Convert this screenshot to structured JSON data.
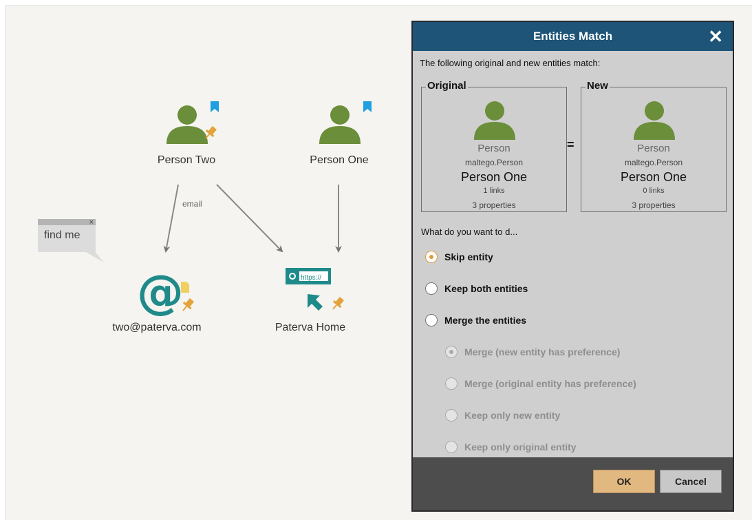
{
  "graph": {
    "nodes": [
      {
        "id": "person-two",
        "label": "Person Two",
        "icon": "person-icon",
        "bookmark": true,
        "pinned": true
      },
      {
        "id": "person-one",
        "label": "Person One",
        "icon": "person-icon",
        "bookmark": true,
        "pinned": false
      },
      {
        "id": "email",
        "label": "two@paterva.com",
        "icon": "email-at-icon",
        "note_attached": true,
        "pinned": true
      },
      {
        "id": "website",
        "label": "Paterva Home",
        "icon": "website-icon",
        "url_badge": "https://",
        "pinned": true
      }
    ],
    "edges": [
      {
        "from": "person-two",
        "to": "email",
        "label": "email"
      },
      {
        "from": "person-two",
        "to": "website",
        "label": ""
      },
      {
        "from": "person-one",
        "to": "website",
        "label": ""
      }
    ],
    "note": {
      "text": "find me",
      "close": "×"
    }
  },
  "dialog": {
    "title": "Entities Match",
    "close": "✕",
    "intro": "The following original and new entities match:",
    "original": {
      "legend": "Original",
      "type": "Person",
      "namespace": "maltego.Person",
      "name": "Person One",
      "links": "1 links",
      "properties": "3 properties"
    },
    "new": {
      "legend": "New",
      "type": "Person",
      "namespace": "maltego.Person",
      "name": "Person One",
      "links": "0 links",
      "properties": "3 properties"
    },
    "equals": "=",
    "question": "What do you want to d...",
    "options": [
      {
        "label": "Skip entity",
        "checked": true,
        "enabled": true
      },
      {
        "label": "Keep both entities",
        "checked": false,
        "enabled": true
      },
      {
        "label": "Merge the entities",
        "checked": false,
        "enabled": true
      }
    ],
    "merge_options": [
      {
        "label": "Merge (new entity has preference)",
        "checked": true,
        "enabled": false
      },
      {
        "label": "Merge (original entity has preference)",
        "checked": false,
        "enabled": false
      },
      {
        "label": "Keep only new entity",
        "checked": false,
        "enabled": false
      },
      {
        "label": "Keep only original entity",
        "checked": false,
        "enabled": false
      }
    ],
    "buttons": {
      "ok": "OK",
      "cancel": "Cancel"
    }
  },
  "colors": {
    "person": "#6b8e3a",
    "entity_teal": "#1f8a8a",
    "pin": "#e3a33a",
    "bookmark": "#1fa0e0",
    "title_bar": "#1d5478",
    "ok_button": "#e2b881"
  }
}
